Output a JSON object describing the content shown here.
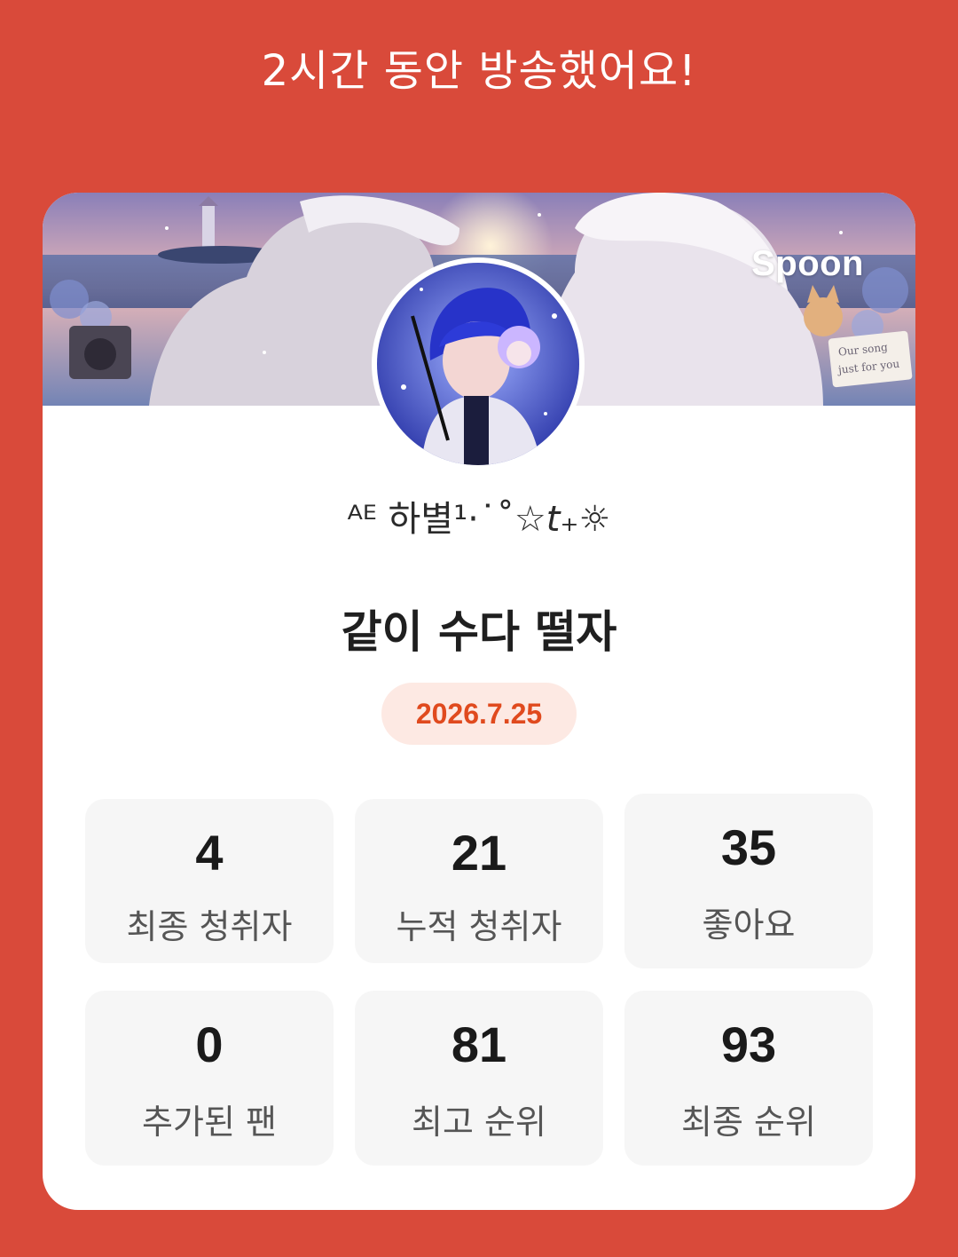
{
  "header": {
    "message": "2시간 동안 방송했어요!"
  },
  "card": {
    "brand": "Spoon",
    "banner_sign": "Our song just for you",
    "nickname": "ᴬᴱ 하별¹·˙˚☆𝘵₊☼",
    "live_title": "같이 수다 떨자",
    "date": "2026.7.25"
  },
  "stats": [
    {
      "value": "4",
      "label": "최종 청취자"
    },
    {
      "value": "21",
      "label": "누적 청취자"
    },
    {
      "value": "35",
      "label": "좋아요"
    },
    {
      "value": "0",
      "label": "추가된 팬"
    },
    {
      "value": "81",
      "label": "최고 순위"
    },
    {
      "value": "93",
      "label": "최종 순위"
    }
  ],
  "colors": {
    "background": "#d94a3a",
    "card": "#ffffff",
    "date_text": "#e04a1e",
    "date_bg": "#fde9e3",
    "stat_bg": "#f6f6f6"
  }
}
